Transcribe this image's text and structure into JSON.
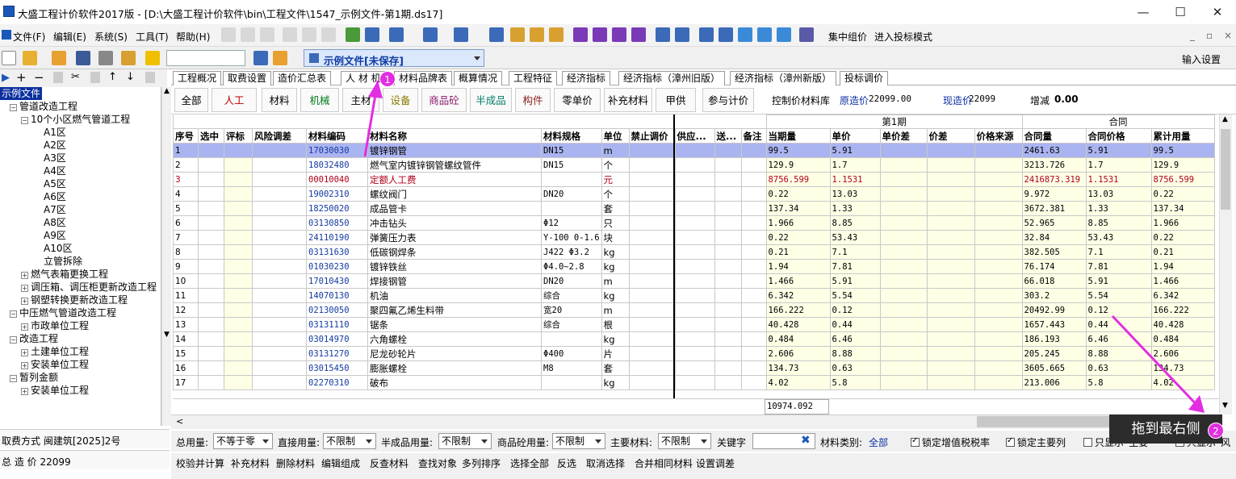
{
  "window": {
    "title": "大盛工程计价软件2017版 - [D:\\大盛工程计价软件\\bin\\工程文件\\1547_示例文件-第1期.ds17]",
    "minimize": "—",
    "maximize": "☐",
    "close": "✕"
  },
  "menu": {
    "items": [
      "文件(F)",
      "编辑(E)",
      "系统(S)",
      "工具(T)",
      "帮助(H)"
    ],
    "right_items": [
      "集中组价",
      "进入投标模式"
    ],
    "mdi_buttons": [
      "_",
      "▫",
      "×"
    ]
  },
  "toolbar2": {
    "project_combo": "示例文件[未保存]",
    "input_settings": "输入设置"
  },
  "tree": {
    "nodes": [
      {
        "label": "示例文件",
        "level": 0,
        "expander": "",
        "selected": true
      },
      {
        "label": "管道改造工程",
        "level": 1,
        "expander": "-"
      },
      {
        "label": "10个小区燃气管道工程",
        "level": 2,
        "expander": "-"
      },
      {
        "label": "A1区",
        "level": 3,
        "expander": ""
      },
      {
        "label": "A2区",
        "level": 3,
        "expander": ""
      },
      {
        "label": "A3区",
        "level": 3,
        "expander": ""
      },
      {
        "label": "A4区",
        "level": 3,
        "expander": ""
      },
      {
        "label": "A5区",
        "level": 3,
        "expander": ""
      },
      {
        "label": "A6区",
        "level": 3,
        "expander": ""
      },
      {
        "label": "A7区",
        "level": 3,
        "expander": ""
      },
      {
        "label": "A8区",
        "level": 3,
        "expander": ""
      },
      {
        "label": "A9区",
        "level": 3,
        "expander": ""
      },
      {
        "label": "A10区",
        "level": 3,
        "expander": ""
      },
      {
        "label": "立管拆除",
        "level": 3,
        "expander": ""
      },
      {
        "label": "燃气表箱更换工程",
        "level": 2,
        "expander": "+"
      },
      {
        "label": "调压箱、调压柜更新改造工程",
        "level": 2,
        "expander": "+"
      },
      {
        "label": "钢塑转换更新改造工程",
        "level": 2,
        "expander": "+"
      },
      {
        "label": "中压燃气管道改造工程",
        "level": 1,
        "expander": "-"
      },
      {
        "label": "市政单位工程",
        "level": 2,
        "expander": "+"
      },
      {
        "label": "改造工程",
        "level": 1,
        "expander": "-"
      },
      {
        "label": "土建单位工程",
        "level": 2,
        "expander": "+"
      },
      {
        "label": "安装单位工程",
        "level": 2,
        "expander": "+"
      },
      {
        "label": "暂列金额",
        "level": 1,
        "expander": "-"
      },
      {
        "label": "安装单位工程",
        "level": 2,
        "expander": "+"
      }
    ],
    "info_fee_mode": "取费方式 闽建筑[2025]2号",
    "info_total": "总 造 价 22099"
  },
  "tabs": [
    "工程概况",
    "取费设置",
    "造价汇总表",
    "人 材 机",
    "材料品牌表",
    "概算情况",
    "工程特征",
    "经济指标",
    "经济指标（漳州旧版）",
    "经济指标（漳州新版）",
    "投标调价"
  ],
  "categories": [
    {
      "label": "全部",
      "color": "#000000"
    },
    {
      "label": "人工",
      "color": "#c00000"
    },
    {
      "label": "材料",
      "color": "#000000"
    },
    {
      "label": "机械",
      "color": "#007a1a"
    },
    {
      "label": "主材",
      "color": "#000000"
    },
    {
      "label": "设备",
      "color": "#8a7a00"
    },
    {
      "label": "商品砼",
      "color": "#8a1a6a"
    },
    {
      "label": "半成品",
      "color": "#007a6a"
    },
    {
      "label": "构件",
      "color": "#8a1a1a"
    },
    {
      "label": "零单价",
      "color": "#000000"
    },
    {
      "label": "补充材料",
      "color": "#000000"
    },
    {
      "label": "甲供",
      "color": "#000000"
    },
    {
      "label": "参与计价",
      "color": "#000000"
    }
  ],
  "summary": {
    "control_label": "控制价材料库",
    "orig_label": "原造价",
    "orig_value": "22099.00",
    "curr_label": "现造价",
    "curr_value": "22099",
    "diff_label": "增减",
    "diff_value": "0.00"
  },
  "grid": {
    "group_period": "第1期",
    "group_contract": "合同",
    "headers": [
      "序号",
      "选中",
      "评标",
      "风险调差",
      "材料编码",
      "材料名称",
      "材料规格",
      "单位",
      "禁止调价",
      "供应...",
      "送...",
      "备注",
      "当期量",
      "单价",
      "单价差",
      "价差",
      "价格来源",
      "合同量",
      "合同价格",
      "累计用量"
    ],
    "rows": [
      {
        "seq": "1",
        "code": "17030030",
        "name": "镀锌钢管",
        "spec": "DN15",
        "unit": "m",
        "qty": "99.5",
        "price": "5.91",
        "cqty": "2461.63",
        "cprice": "5.91",
        "cum": "99.5",
        "selected": true
      },
      {
        "seq": "2",
        "code": "18032480",
        "name": "燃气室内镀锌钢管螺纹管件",
        "spec": "DN15",
        "unit": "个",
        "qty": "129.9",
        "price": "1.7",
        "cqty": "3213.726",
        "cprice": "1.7",
        "cum": "129.9"
      },
      {
        "seq": "3",
        "code": "00010040",
        "name": "定额人工费",
        "spec": "",
        "unit": "元",
        "qty": "8756.599",
        "price": "1.1531",
        "cqty": "2416873.319",
        "cprice": "1.1531",
        "cum": "8756.599",
        "red": true
      },
      {
        "seq": "4",
        "code": "19002310",
        "name": "螺纹阀门",
        "spec": "DN20",
        "unit": "个",
        "qty": "0.22",
        "price": "13.03",
        "cqty": "9.972",
        "cprice": "13.03",
        "cum": "0.22"
      },
      {
        "seq": "5",
        "code": "18250020",
        "name": "成品管卡",
        "spec": "",
        "unit": "套",
        "qty": "137.34",
        "price": "1.33",
        "cqty": "3672.381",
        "cprice": "1.33",
        "cum": "137.34"
      },
      {
        "seq": "6",
        "code": "03130850",
        "name": "冲击钻头",
        "spec": "Φ12",
        "unit": "只",
        "qty": "1.966",
        "price": "8.85",
        "cqty": "52.965",
        "cprice": "8.85",
        "cum": "1.966"
      },
      {
        "seq": "7",
        "code": "24110190",
        "name": "弹簧压力表",
        "spec": "Y-100 0-1.6",
        "unit": "块",
        "qty": "0.22",
        "price": "53.43",
        "cqty": "32.84",
        "cprice": "53.43",
        "cum": "0.22"
      },
      {
        "seq": "8",
        "code": "03131630",
        "name": "低碳钢焊条",
        "spec": "J422 Φ3.2",
        "unit": "kg",
        "qty": "0.21",
        "price": "7.1",
        "cqty": "382.505",
        "cprice": "7.1",
        "cum": "0.21"
      },
      {
        "seq": "9",
        "code": "01030230",
        "name": "镀锌铁丝",
        "spec": "Φ4.0~2.8",
        "unit": "kg",
        "qty": "1.94",
        "price": "7.81",
        "cqty": "76.174",
        "cprice": "7.81",
        "cum": "1.94"
      },
      {
        "seq": "10",
        "code": "17010430",
        "name": "焊接钢管",
        "spec": "DN20",
        "unit": "m",
        "qty": "1.466",
        "price": "5.91",
        "cqty": "66.018",
        "cprice": "5.91",
        "cum": "1.466"
      },
      {
        "seq": "11",
        "code": "14070130",
        "name": "机油",
        "spec": "综合",
        "unit": "kg",
        "qty": "6.342",
        "price": "5.54",
        "cqty": "303.2",
        "cprice": "5.54",
        "cum": "6.342"
      },
      {
        "seq": "12",
        "code": "02130050",
        "name": "聚四氟乙烯生料带",
        "spec": "宽20",
        "unit": "m",
        "qty": "166.222",
        "price": "0.12",
        "cqty": "20492.99",
        "cprice": "0.12",
        "cum": "166.222"
      },
      {
        "seq": "13",
        "code": "03131110",
        "name": "锯条",
        "spec": "综合",
        "unit": "根",
        "qty": "40.428",
        "price": "0.44",
        "cqty": "1657.443",
        "cprice": "0.44",
        "cum": "40.428"
      },
      {
        "seq": "14",
        "code": "03014970",
        "name": "六角螺栓",
        "spec": "",
        "unit": "kg",
        "qty": "0.484",
        "price": "6.46",
        "cqty": "186.193",
        "cprice": "6.46",
        "cum": "0.484"
      },
      {
        "seq": "15",
        "code": "03131270",
        "name": "尼龙砂轮片",
        "spec": "Φ400",
        "unit": "片",
        "qty": "2.606",
        "price": "8.88",
        "cqty": "205.245",
        "cprice": "8.88",
        "cum": "2.606"
      },
      {
        "seq": "16",
        "code": "03015450",
        "name": "膨胀螺栓",
        "spec": "M8",
        "unit": "套",
        "qty": "134.73",
        "price": "0.63",
        "cqty": "3605.665",
        "cprice": "0.63",
        "cum": "134.73"
      },
      {
        "seq": "17",
        "code": "02270310",
        "name": "破布",
        "spec": "",
        "unit": "kg",
        "qty": "4.02",
        "price": "5.8",
        "cqty": "213.006",
        "cprice": "5.8",
        "cum": "4.02"
      }
    ],
    "footer_total": "10974.092"
  },
  "filters": {
    "total_label": "总用量:",
    "total_value": "不等于零",
    "direct_label": "直接用量:",
    "direct_value": "不限制",
    "semi_label": "半成品用量:",
    "semi_value": "不限制",
    "concrete_label": "商品砼用量:",
    "concrete_value": "不限制",
    "main_label": "主要材料:",
    "main_value": "不限制",
    "keyword_label": "关键字",
    "category_label": "材料类别:",
    "category_value": "全部",
    "lock_tax": "锁定增值税税率",
    "lock_main": "锁定主要列",
    "only_main": "只显示“主要”",
    "only_show": "只显示“风"
  },
  "actions": [
    "校验并计算",
    "补充材料",
    "删除材料",
    "编辑组成",
    "反查材料",
    "查找对象",
    "多列排序",
    "选择全部",
    "反选",
    "取消选择",
    "合并相同材料",
    "设置调差"
  ],
  "annotation": {
    "tooltip": "拖到最右侧",
    "badge1": "1",
    "badge2": "2",
    "color": "#e22ee0"
  }
}
